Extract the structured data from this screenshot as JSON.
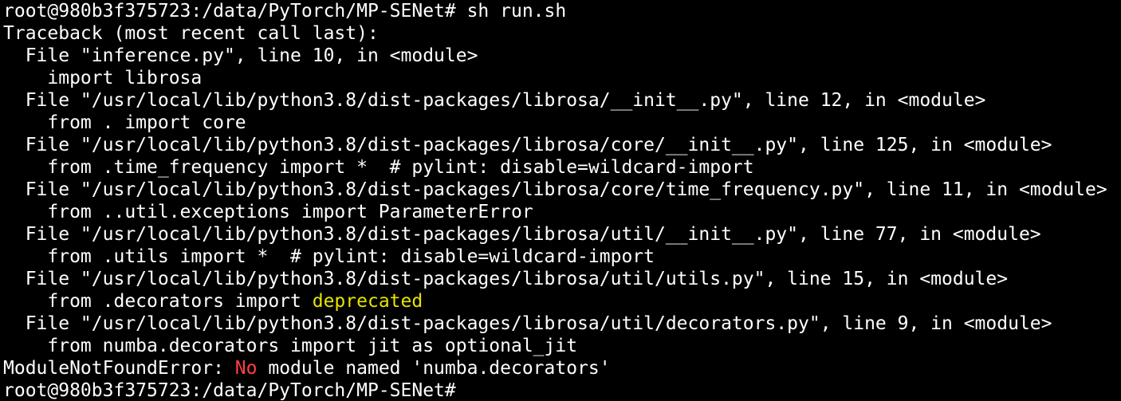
{
  "colors": {
    "background": "#000000",
    "foreground": "#ffffff",
    "highlight_yellow": "#e5e500",
    "highlight_red": "#ff4040"
  },
  "terminal": {
    "prompt_command": "root@980b3f375723:/data/PyTorch/MP-SENet# sh run.sh",
    "traceback_header": "Traceback (most recent call last):",
    "frames": [
      {
        "file_line": "  File \"inference.py\", line 10, in <module>",
        "code": "    import librosa"
      },
      {
        "file_line": "  File \"/usr/local/lib/python3.8/dist-packages/librosa/__init__.py\", line 12, in <module>",
        "code": "    from . import core"
      },
      {
        "file_line": "  File \"/usr/local/lib/python3.8/dist-packages/librosa/core/__init__.py\", line 125, in <module>",
        "code": "    from .time_frequency import *  # pylint: disable=wildcard-import"
      },
      {
        "file_line": "  File \"/usr/local/lib/python3.8/dist-packages/librosa/core/time_frequency.py\", line 11, in <module>",
        "code": "    from ..util.exceptions import ParameterError"
      },
      {
        "file_line": "  File \"/usr/local/lib/python3.8/dist-packages/librosa/util/__init__.py\", line 77, in <module>",
        "code": "    from .utils import *  # pylint: disable=wildcard-import"
      },
      {
        "file_line": "  File \"/usr/local/lib/python3.8/dist-packages/librosa/util/utils.py\", line 15, in <module>",
        "code_prefix": "    from .decorators import ",
        "code_highlight": "deprecated"
      },
      {
        "file_line": "  File \"/usr/local/lib/python3.8/dist-packages/librosa/util/decorators.py\", line 9, in <module>",
        "code": "    from numba.decorators import jit as optional_jit"
      }
    ],
    "error": {
      "prefix": "ModuleNotFoundError: ",
      "highlight": "No",
      "suffix": " module named 'numba.decorators'"
    },
    "final_prompt": "root@980b3f375723:/data/PyTorch/MP-SENet#"
  }
}
